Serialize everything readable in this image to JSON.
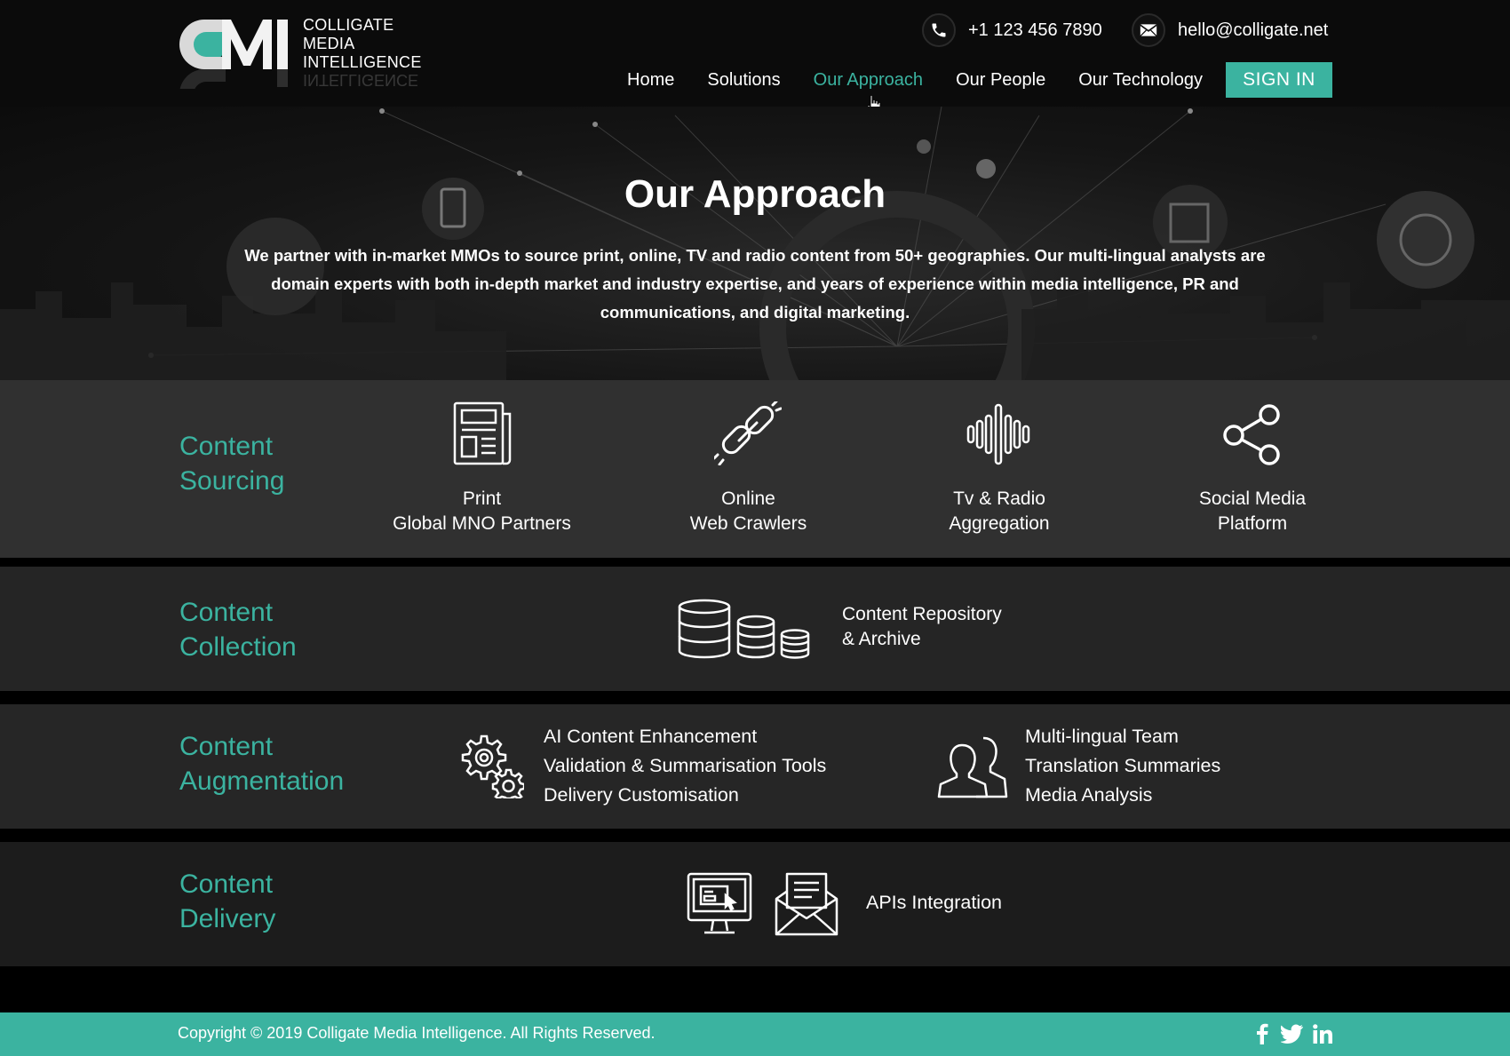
{
  "brand": {
    "logo_mark": "CMI",
    "logo_lines": [
      "COLLIGATE",
      "MEDIA",
      "INTELLIGENCE"
    ]
  },
  "header": {
    "phone": "+1 123 456 7890",
    "email": "hello@colligate.net",
    "phone_icon": "phone-icon",
    "email_icon": "envelope-icon"
  },
  "nav": {
    "items": [
      "Home",
      "Solutions",
      "Our Approach",
      "Our People",
      "Our Technology"
    ],
    "active": "Our Approach",
    "signin_label": "SIGN IN"
  },
  "hero": {
    "title": "Our Approach",
    "intro": "We partner with in-market MMOs to source print, online, TV and radio content from 50+ geographies. Our multi-lingual analysts are domain experts with both in-depth market and industry expertise, and years of experience within media intelligence, PR and communications, and digital marketing."
  },
  "sourcing": {
    "label_lines": [
      "Content",
      "Sourcing"
    ],
    "items": [
      {
        "icon": "newspaper-icon",
        "lines": [
          "Print",
          "Global MNO Partners"
        ]
      },
      {
        "icon": "chain-link-icon",
        "lines": [
          "Online",
          "Web Crawlers"
        ]
      },
      {
        "icon": "sound-wave-icon",
        "lines": [
          "Tv & Radio",
          "Aggregation"
        ]
      },
      {
        "icon": "share-icon",
        "lines": [
          "Social Media",
          "Platform"
        ]
      }
    ]
  },
  "collection": {
    "label_lines": [
      "Content",
      "Collection"
    ],
    "icon": "database-icon",
    "lines": [
      "Content Repository",
      "& Archive"
    ]
  },
  "augmentation": {
    "label_lines": [
      "Content",
      "Augmentation"
    ],
    "groups": [
      {
        "icon": "gears-icon",
        "lines": [
          "AI Content Enhancement",
          "Validation & Summarisation Tools",
          "Delivery Customisation"
        ]
      },
      {
        "icon": "people-icon",
        "lines": [
          "Multi-lingual Team",
          "Translation Summaries",
          "Media Analysis"
        ]
      }
    ]
  },
  "delivery": {
    "label_lines": [
      "Content",
      "Delivery"
    ],
    "icons": [
      "monitor-icon",
      "open-envelope-icon"
    ],
    "text": "APIs Integration"
  },
  "footer": {
    "copyright": "Copyright © 2019 Colligate Media Intelligence. All Rights Reserved.",
    "social_icons": [
      "facebook-icon",
      "twitter-icon",
      "linkedin-icon"
    ]
  },
  "colors": {
    "accent": "#3bb3a0",
    "background": "#000000",
    "row_band": "#2a2a2a"
  }
}
